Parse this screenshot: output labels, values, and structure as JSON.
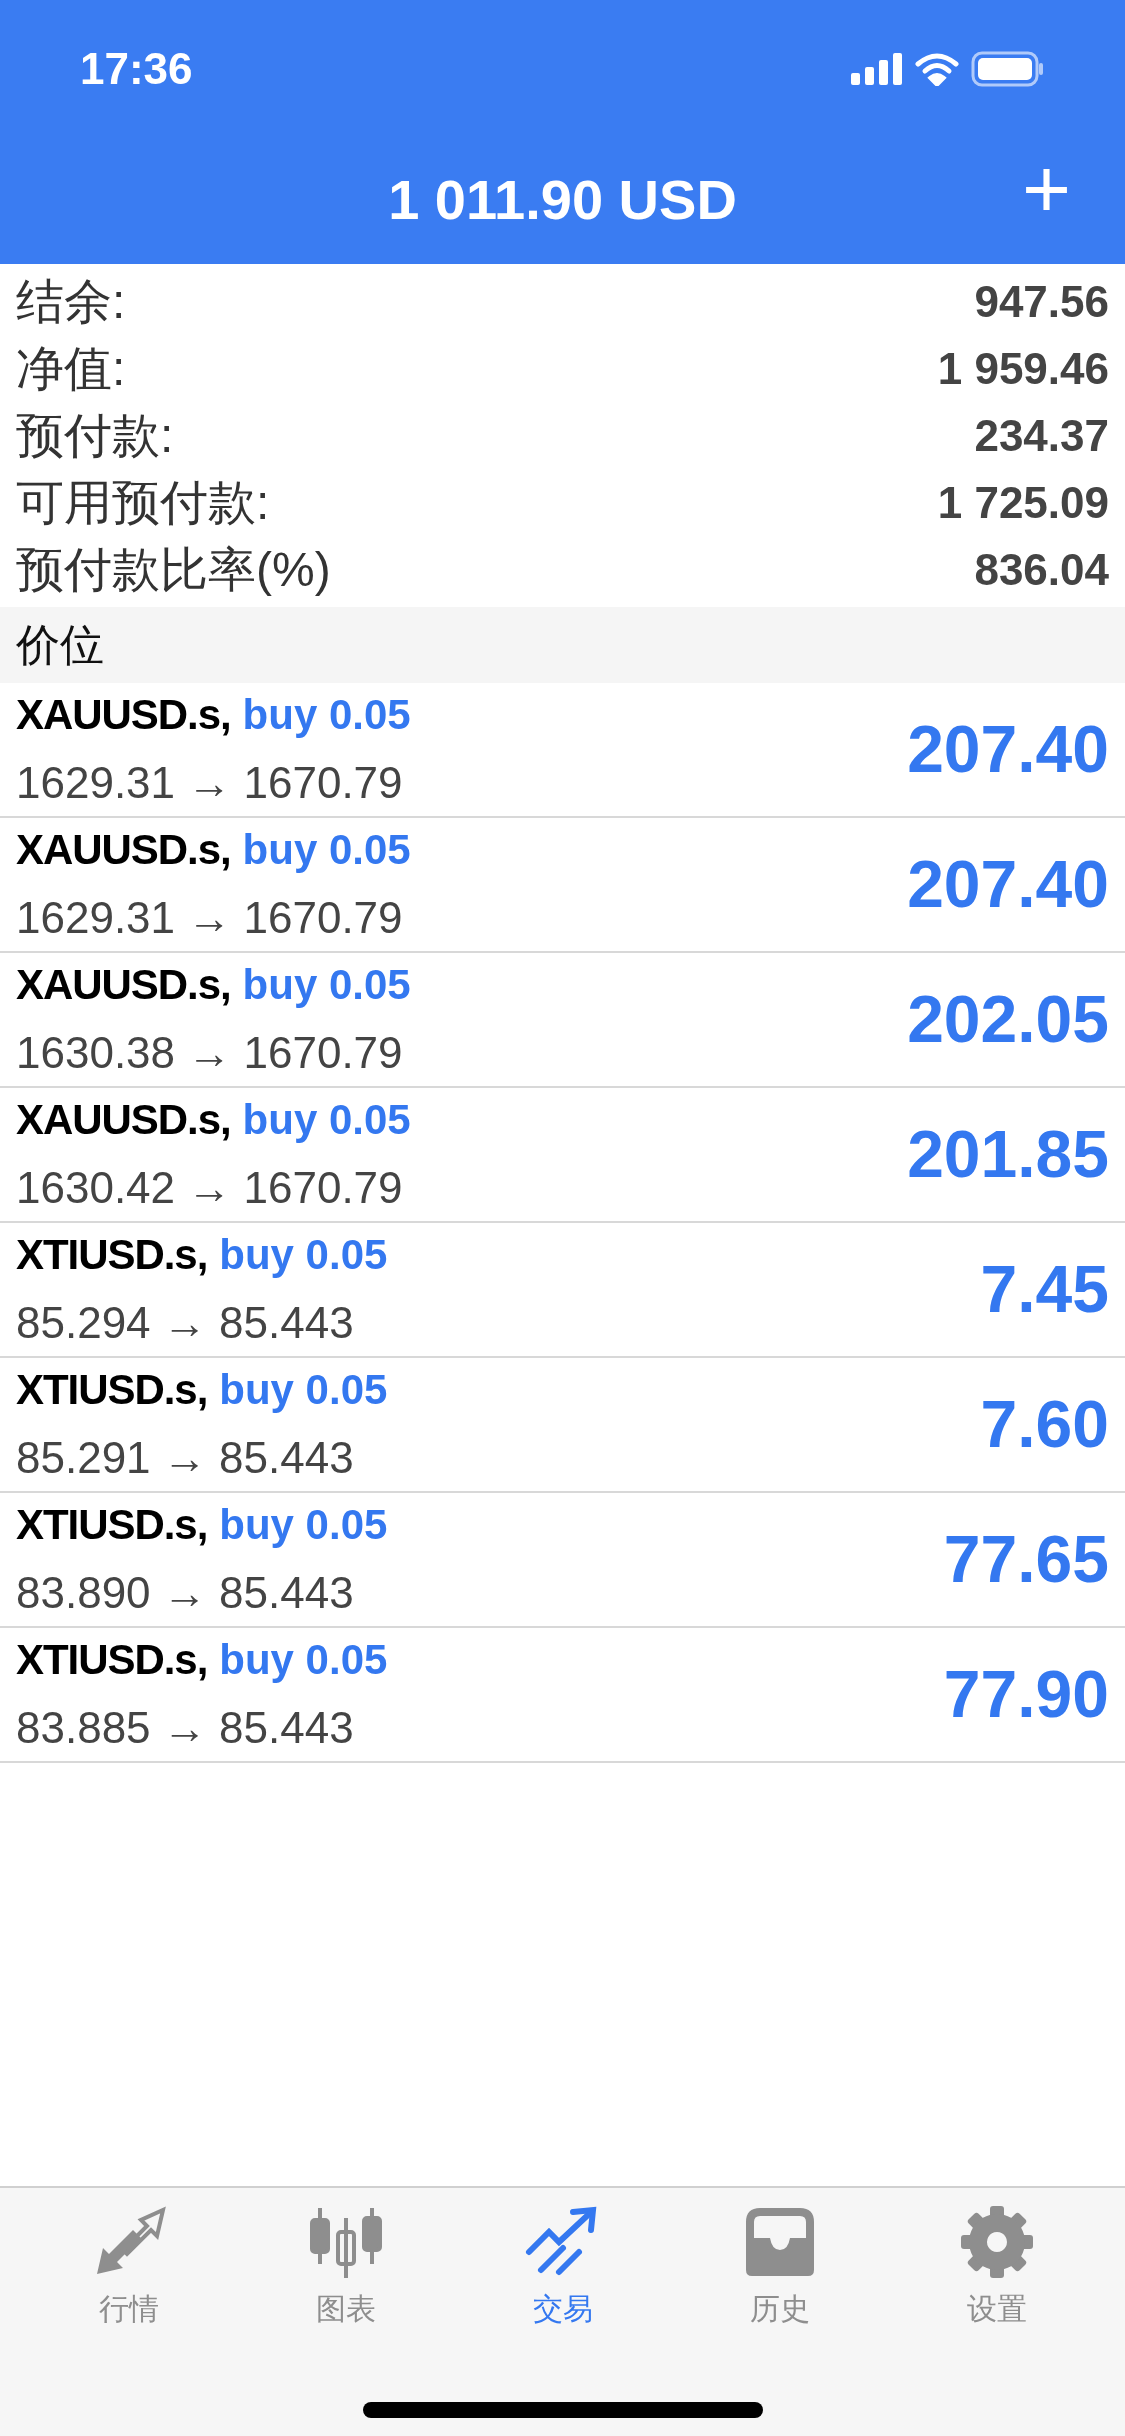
{
  "status_bar": {
    "time": "17:36"
  },
  "header": {
    "title": "1 011.90 USD",
    "add_button": "+"
  },
  "summary": [
    {
      "label": "结余:",
      "value": "947.56"
    },
    {
      "label": "净值:",
      "value": "1 959.46"
    },
    {
      "label": "预付款:",
      "value": "234.37"
    },
    {
      "label": "可用预付款:",
      "value": "1 725.09"
    },
    {
      "label": "预付款比率(%)",
      "value": "836.04"
    }
  ],
  "section_title": "价位",
  "positions": [
    {
      "symbol": "XAUUSD.s,",
      "order": "buy 0.05",
      "prices": "1629.31 → 1670.79",
      "profit": "207.40"
    },
    {
      "symbol": "XAUUSD.s,",
      "order": "buy 0.05",
      "prices": "1629.31 → 1670.79",
      "profit": "207.40"
    },
    {
      "symbol": "XAUUSD.s,",
      "order": "buy 0.05",
      "prices": "1630.38 → 1670.79",
      "profit": "202.05"
    },
    {
      "symbol": "XAUUSD.s,",
      "order": "buy 0.05",
      "prices": "1630.42 → 1670.79",
      "profit": "201.85"
    },
    {
      "symbol": "XTIUSD.s,",
      "order": "buy 0.05",
      "prices": "85.294 → 85.443",
      "profit": "7.45"
    },
    {
      "symbol": "XTIUSD.s,",
      "order": "buy 0.05",
      "prices": "85.291 → 85.443",
      "profit": "7.60"
    },
    {
      "symbol": "XTIUSD.s,",
      "order": "buy 0.05",
      "prices": "83.890 → 85.443",
      "profit": "77.65"
    },
    {
      "symbol": "XTIUSD.s,",
      "order": "buy 0.05",
      "prices": "83.885 → 85.443",
      "profit": "77.90"
    }
  ],
  "tabs": [
    {
      "kind": "quotes",
      "label": "行情",
      "selected": false
    },
    {
      "kind": "chart",
      "label": "图表",
      "selected": false
    },
    {
      "kind": "trade",
      "label": "交易",
      "selected": true
    },
    {
      "kind": "history",
      "label": "历史",
      "selected": false
    },
    {
      "kind": "settings",
      "label": "设置",
      "selected": false
    }
  ]
}
